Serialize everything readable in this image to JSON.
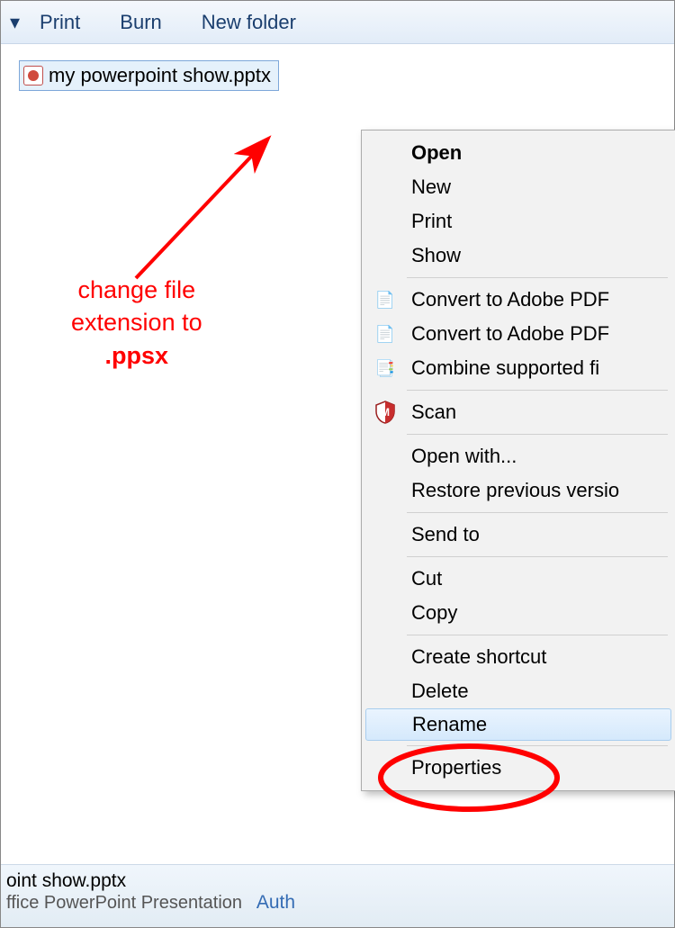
{
  "toolbar": {
    "print": "Print",
    "burn": "Burn",
    "new_folder": "New folder"
  },
  "file": {
    "name": "my powerpoint show.pptx"
  },
  "annotation": {
    "line1": "change file",
    "line2": "extension to",
    "line3": ".ppsx"
  },
  "context_menu": {
    "open": "Open",
    "new": "New",
    "print": "Print",
    "show": "Show",
    "convert_pdf1": "Convert to Adobe PDF",
    "convert_pdf2": "Convert to Adobe PDF",
    "combine": "Combine supported fi",
    "scan": "Scan",
    "open_with": "Open with...",
    "restore": "Restore previous versio",
    "send_to": "Send to",
    "cut": "Cut",
    "copy": "Copy",
    "create_shortcut": "Create shortcut",
    "delete": "Delete",
    "rename": "Rename",
    "properties": "Properties"
  },
  "footer": {
    "filename": "oint show.pptx",
    "filetype": "ffice PowerPoint Presentation",
    "auth_label": "Auth"
  }
}
